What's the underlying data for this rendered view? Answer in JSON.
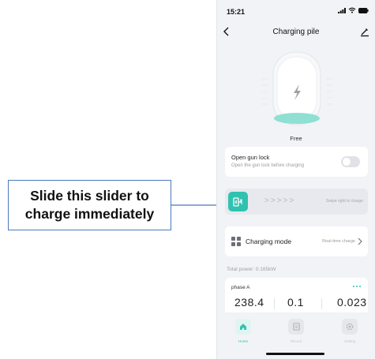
{
  "annotation": {
    "line1": "Slide this slider to",
    "line2": "charge immediately",
    "color": "#4a7bbf"
  },
  "status_bar": {
    "time": "15:21",
    "icons": [
      "signal-icon",
      "wifi-icon",
      "battery-icon"
    ]
  },
  "nav": {
    "title": "Charging pile",
    "back_icon": "chevron-left-icon",
    "edit_icon": "pencil-icon"
  },
  "device": {
    "status": "Free",
    "icon": "lightning-icon",
    "accent": "#8fe0d3"
  },
  "gun_lock": {
    "title": "Open gun lock",
    "subtitle": "Open the gun lock before charging",
    "toggle_on": false
  },
  "slider": {
    "arrows": ">>>>>",
    "hint": "Swipe right to charge",
    "accent": "#2fc2b0"
  },
  "charging_mode": {
    "label": "Charging mode",
    "value": "Real-time charge"
  },
  "total_power": "Total power: 0.165kW",
  "phase": {
    "name": "phase A",
    "values": [
      "238.4",
      "0.1",
      "0.023"
    ]
  },
  "tabs": [
    {
      "label": "Home",
      "icon": "home-icon",
      "active": true
    },
    {
      "label": "Record",
      "icon": "record-icon",
      "active": false
    },
    {
      "label": "Setting",
      "icon": "gear-icon",
      "active": false
    }
  ],
  "colors": {
    "accent": "#2fc2b0",
    "background": "#f2f3f6",
    "card": "#ffffff"
  }
}
